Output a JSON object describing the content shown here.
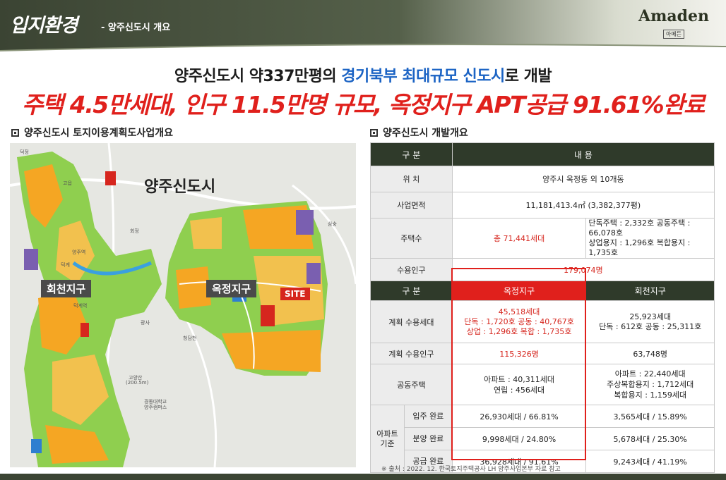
{
  "header": {
    "title": "입지환경",
    "subtitle": "- 양주신도시 개요",
    "brand_name": "Amaden",
    "brand_sub": "아메든"
  },
  "headline": {
    "line1_a": "양주신도시 약337만평의 ",
    "line1_highlight": "경기북부 최대규모 신도시",
    "line1_b": "로 개발",
    "line2": "주택 4.5만세대, 인구 11.5만명 규모, 옥정지구 APT공급 91.61%완료"
  },
  "sections": {
    "left_title": "양주신도시 토지이용계획도사업개요",
    "right_title": "양주신도시 개발개요"
  },
  "map": {
    "city_label": "양주신도시",
    "zone_left": "회천지구",
    "zone_right": "옥정지구",
    "site_tag": "SITE",
    "small_labels": [
      "덕정",
      "고읍",
      "회정",
      "덕계",
      "광사",
      "삼숭",
      "고양산",
      "(200.5m)",
      "경동대학교",
      "양주캠퍼스",
      "청담천",
      "덕계역",
      "양주역"
    ]
  },
  "table": {
    "overview_header": [
      "구 분",
      "내 용"
    ],
    "overview_rows": [
      {
        "label": "위 치",
        "value": "양주시 옥정동 외 10개동"
      },
      {
        "label": "사업면적",
        "value": "11,181,413.4㎡ (3,382,377평)"
      }
    ],
    "housing": {
      "label": "주택수",
      "total": "총 71,441세대",
      "detail_line1": "단독주택 : 2,332호   공동주택 : 66,078호",
      "detail_line2": "상업용지 : 1,296호   복합용지 : 1,735호"
    },
    "population": {
      "label": "수용인구",
      "value": "179,074명"
    },
    "district_header": [
      "구 분",
      "옥정지구",
      "회천지구"
    ],
    "planned_households": {
      "label": "계획 수용세대",
      "okjeong": [
        "45,518세대",
        "단독 : 1,720호 공동 : 40,767호",
        "상업 : 1,296호 복합 : 1,735호"
      ],
      "hoecheon": [
        "25,923세대",
        "단독 : 612호 공동 : 25,311호"
      ]
    },
    "planned_population": {
      "label": "계획 수용인구",
      "okjeong": "115,326명",
      "hoecheon": "63,748명"
    },
    "multi_housing": {
      "label": "공동주택",
      "okjeong": [
        "아파트 : 40,311세대",
        "연립 : 456세대"
      ],
      "hoecheon": [
        "아파트 : 22,440세대",
        "주상복합용지 : 1,712세대",
        "복합용지 : 1,159세대"
      ]
    },
    "apt_label": "아파트 기준",
    "apt_rows": [
      {
        "label": "입주 완료",
        "okjeong": "26,930세대 / 66.81%",
        "hoecheon": "3,565세대 / 15.89%"
      },
      {
        "label": "분양 완료",
        "okjeong": "9,998세대 / 24.80%",
        "hoecheon": "5,678세대 / 25.30%"
      },
      {
        "label": "공급 완료",
        "okjeong": "36,928세대 / 91.61%",
        "hoecheon": "9,243세대 / 41.19%"
      }
    ]
  },
  "footnote": "※ 출처 : 2022. 12. 한국토지주택공사 LH 양주사업본부 자료 참고"
}
